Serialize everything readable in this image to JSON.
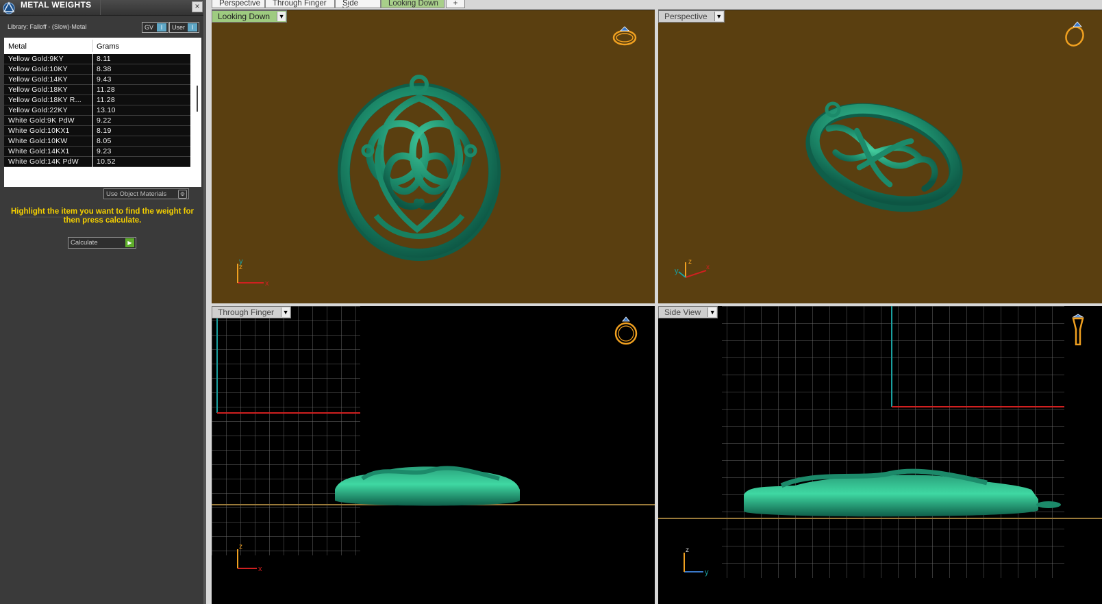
{
  "panel": {
    "title": "METAL WEIGHTS",
    "close_icon": "×",
    "library_label": "Library: Falloff - (Slow)-Metal",
    "gv_toggle": {
      "label": "GV",
      "value": "I"
    },
    "user_toggle": {
      "label": "User",
      "value": "I"
    },
    "table": {
      "columns": [
        "Metal",
        "Grams"
      ],
      "rows": [
        {
          "metal": "Yellow Gold:9KY",
          "grams": "8.11"
        },
        {
          "metal": "Yellow Gold:10KY",
          "grams": "8.38"
        },
        {
          "metal": "Yellow Gold:14KY",
          "grams": "9.43"
        },
        {
          "metal": "Yellow Gold:18KY",
          "grams": "11.28"
        },
        {
          "metal": "Yellow Gold:18KY R...",
          "grams": "11.28"
        },
        {
          "metal": "Yellow Gold:22KY",
          "grams": "13.10"
        },
        {
          "metal": "White Gold:9K PdW",
          "grams": "9.22"
        },
        {
          "metal": "White Gold:10KX1",
          "grams": "8.19"
        },
        {
          "metal": "White Gold:10KW",
          "grams": "8.05"
        },
        {
          "metal": "White Gold:14KX1",
          "grams": "9.23"
        },
        {
          "metal": "White Gold:14K PdW",
          "grams": "10.52"
        }
      ]
    },
    "object_materials_label": "Use Object Materials",
    "hint": "Highlight the item you want to find the weight for then press calculate.",
    "calculate_label": "Calculate"
  },
  "tabs": [
    "Perspective",
    "Through Finger",
    "Side View",
    "Looking Down"
  ],
  "active_tab": "Looking Down",
  "add_tab_icon": "+",
  "viewports": {
    "top_left": {
      "label": "Looking Down",
      "axes": [
        "y",
        "z",
        "x"
      ]
    },
    "top_right": {
      "label": "Perspective",
      "axes": [
        "y",
        "z",
        "x"
      ]
    },
    "bottom_left": {
      "label": "Through Finger",
      "axes": [
        "z",
        "x"
      ]
    },
    "bottom_right": {
      "label": "Side View",
      "axes": [
        "z",
        "y"
      ]
    }
  },
  "icons": {
    "app_logo": "matrix-logo-icon",
    "dropdown": "chevron-down-icon",
    "view_cube_ring": "ring-icon",
    "calculate_play": "play-icon"
  },
  "colors": {
    "pendant_green": "#1c8a6a",
    "viewport_brown": "#5a3f10",
    "active_tab_green": "#a8cf8a",
    "hint_yellow": "#f5d000",
    "axis_red": "#d02020",
    "axis_cyan": "#1aa0a0",
    "axis_blue": "#3a78c8",
    "ring_orange": "#f0a020"
  }
}
